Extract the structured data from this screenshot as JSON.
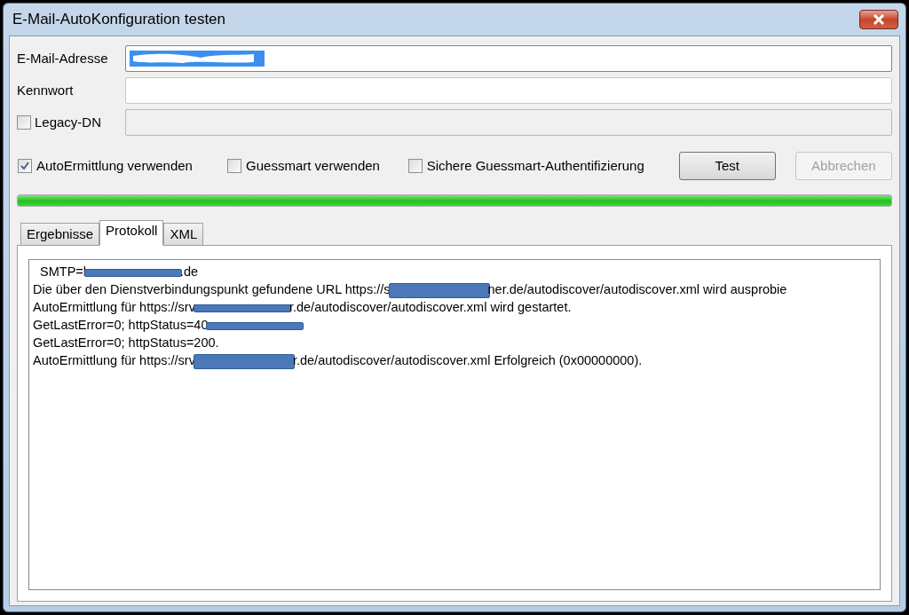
{
  "window": {
    "title": "E-Mail-AutoKonfiguration testen"
  },
  "fields": [
    {
      "label": "E-Mail-Adresse",
      "kind": "text",
      "redacted": true,
      "focused": true
    },
    {
      "label": "Kennwort",
      "kind": "text",
      "redacted": false,
      "focused": false
    },
    {
      "label": "Legacy-DN",
      "kind": "checkbox",
      "checked": false,
      "disabled": true
    }
  ],
  "options": [
    {
      "label": "AutoErmittlung verwenden",
      "checked": true
    },
    {
      "label": "Guessmart verwenden",
      "checked": false
    },
    {
      "label": "Sichere Guessmart-Authentifizierung",
      "checked": false
    }
  ],
  "buttons": [
    {
      "label": "Test",
      "disabled": false
    },
    {
      "label": "Abbrechen",
      "disabled": true
    }
  ],
  "progress": {
    "level": 1
  },
  "tabs": [
    {
      "label": "Ergebnisse",
      "selected": false
    },
    {
      "label": "Protokoll",
      "selected": true
    },
    {
      "label": "XML",
      "selected": false
    }
  ],
  "log": [
    {
      "parts": [
        {
          "kind": "text",
          "text": "  SMTP=l"
        },
        {
          "kind": "bar"
        },
        {
          "kind": "text",
          "text": ".de"
        }
      ]
    },
    {
      "parts": [
        {
          "kind": "text",
          "text": "Die über den Dienstverbindungspunkt gefundene URL https://s"
        },
        {
          "kind": "block"
        },
        {
          "kind": "text",
          "text": "ner.de/autodiscover/autodiscover.xml wird ausprobie"
        }
      ]
    },
    {
      "parts": [
        {
          "kind": "text",
          "text": "AutoErmittlung für https://srv"
        },
        {
          "kind": "bar"
        },
        {
          "kind": "text",
          "text": "r.de/autodiscover/autodiscover.xml wird gestartet."
        }
      ]
    },
    {
      "parts": [
        {
          "kind": "text",
          "text": "GetLastError=0; httpStatus=40"
        },
        {
          "kind": "bar"
        }
      ]
    },
    {
      "parts": [
        {
          "kind": "text",
          "text": "GetLastError=0; httpStatus=200."
        }
      ]
    },
    {
      "parts": [
        {
          "kind": "text",
          "text": "AutoErmittlung für https://srv"
        },
        {
          "kind": "block"
        },
        {
          "kind": "text",
          "text": "r.de/autodiscover/autodiscover.xml Erfolgreich (0x00000000)."
        }
      ]
    }
  ]
}
